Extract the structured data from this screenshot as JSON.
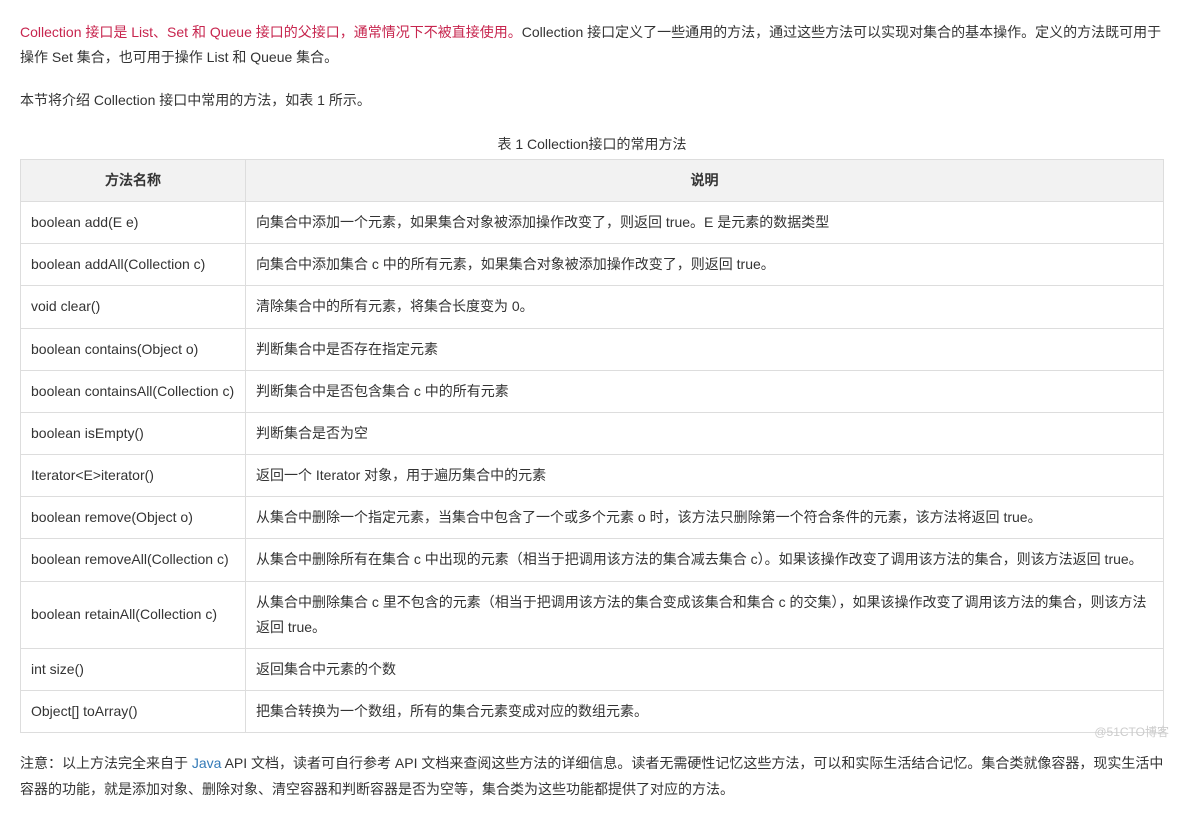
{
  "intro": {
    "highlight": "Collection 接口是 List、Set 和 Queue 接口的父接口，通常情况下不被直接使用。",
    "rest": "Collection 接口定义了一些通用的方法，通过这些方法可以实现对集合的基本操作。定义的方法既可用于操作 Set 集合，也可用于操作 List 和 Queue 集合。"
  },
  "intro2": "本节将介绍 Collection 接口中常用的方法，如表 1 所示。",
  "table": {
    "caption": "表 1 Collection接口的常用方法",
    "headers": {
      "method": "方法名称",
      "description": "说明"
    },
    "rows": [
      {
        "method": "boolean add(E e)",
        "description": "向集合中添加一个元素，如果集合对象被添加操作改变了，则返回 true。E 是元素的数据类型"
      },
      {
        "method": "boolean addAll(Collection c)",
        "description": "向集合中添加集合 c 中的所有元素，如果集合对象被添加操作改变了，则返回 true。"
      },
      {
        "method": "void clear()",
        "description": "清除集合中的所有元素，将集合长度变为 0。"
      },
      {
        "method": "boolean contains(Object o)",
        "description": "判断集合中是否存在指定元素"
      },
      {
        "method": "boolean containsAll(Collection c)",
        "description": "判断集合中是否包含集合 c 中的所有元素"
      },
      {
        "method": "boolean isEmpty()",
        "description": "判断集合是否为空"
      },
      {
        "method": "Iterator<E>iterator()",
        "description": "返回一个 Iterator 对象，用于遍历集合中的元素"
      },
      {
        "method": "boolean remove(Object o)",
        "description": "从集合中删除一个指定元素，当集合中包含了一个或多个元素 o 时，该方法只删除第一个符合条件的元素，该方法将返回 true。"
      },
      {
        "method": "boolean removeAll(Collection c)",
        "description": "从集合中删除所有在集合 c 中出现的元素（相当于把调用该方法的集合减去集合 c）。如果该操作改变了调用该方法的集合，则该方法返回 true。"
      },
      {
        "method": "boolean retainAll(Collection c)",
        "description": "从集合中删除集合 c 里不包含的元素（相当于把调用该方法的集合变成该集合和集合 c 的交集），如果该操作改变了调用该方法的集合，则该方法返回 true。"
      },
      {
        "method": "int size()",
        "description": "返回集合中元素的个数"
      },
      {
        "method": "Object[] toArray()",
        "description": "把集合转换为一个数组，所有的集合元素变成对应的数组元素。"
      }
    ]
  },
  "note": {
    "prefix": "注意：以上方法完全来自于 ",
    "link": "Java",
    "suffix": " API 文档，读者可自行参考 API 文档来查阅这些方法的详细信息。读者无需硬性记忆这些方法，可以和实际生活结合记忆。集合类就像容器，现实生活中容器的功能，就是添加对象、删除对象、清空容器和判断容器是否为空等，集合类为这些功能都提供了对应的方法。"
  },
  "watermark": "@51CTO博客"
}
